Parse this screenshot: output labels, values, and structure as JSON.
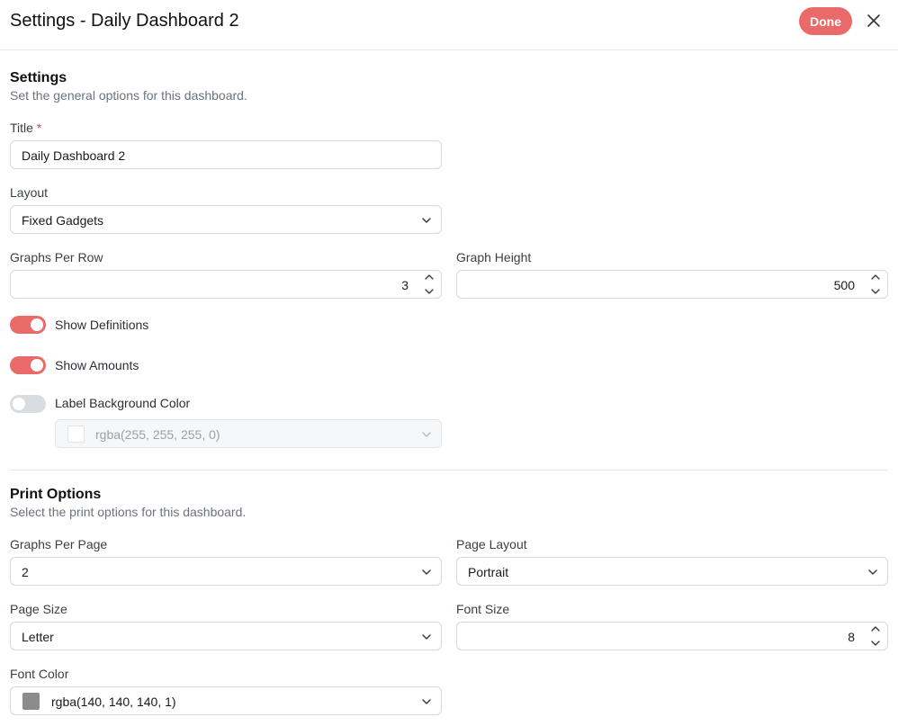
{
  "header": {
    "title": "Settings - Daily Dashboard 2",
    "done_label": "Done"
  },
  "settings": {
    "heading": "Settings",
    "description": "Set the general options for this dashboard.",
    "title_label": "Title",
    "title_required_mark": "*",
    "title_value": "Daily Dashboard 2",
    "layout_label": "Layout",
    "layout_value": "Fixed Gadgets",
    "graphs_per_row_label": "Graphs Per Row",
    "graphs_per_row_value": "3",
    "graph_height_label": "Graph Height",
    "graph_height_value": "500",
    "show_definitions_label": "Show Definitions",
    "show_definitions_on": true,
    "show_amounts_label": "Show Amounts",
    "show_amounts_on": true,
    "label_bg_color_label": "Label Background Color",
    "label_bg_color_on": false,
    "label_bg_color_value": "rgba(255, 255, 255, 0)"
  },
  "print_options": {
    "heading": "Print Options",
    "description": "Select the print options for this dashboard.",
    "graphs_per_page_label": "Graphs Per Page",
    "graphs_per_page_value": "2",
    "page_layout_label": "Page Layout",
    "page_layout_value": "Portrait",
    "page_size_label": "Page Size",
    "page_size_value": "Letter",
    "font_size_label": "Font Size",
    "font_size_value": "8",
    "font_color_label": "Font Color",
    "font_color_value": "rgba(140, 140, 140, 1)"
  },
  "colors": {
    "accent": "#ea6a6a",
    "toggle_off": "#d9dce1",
    "font_color_swatch": "#8c8c8c",
    "label_bg_swatch": "#ffffff"
  },
  "icons": {
    "close": "close-icon",
    "chevron": "chevron-down-icon",
    "spinner": "spinner-arrows-icon"
  }
}
